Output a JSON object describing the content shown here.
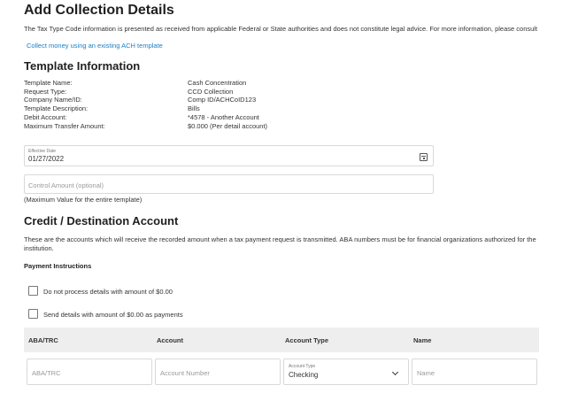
{
  "page": {
    "title": "Add Collection Details",
    "disclaimer": "The Tax Type Code information is presented as received from applicable Federal or State authorities and does not constitute legal advice. For more information, please consult",
    "template_link": "Collect money using an existing ACH template"
  },
  "template_info": {
    "heading": "Template Information",
    "rows": [
      {
        "label": "Template Name:",
        "value": "Cash Concentration"
      },
      {
        "label": "Request Type:",
        "value": "CCD Collection"
      },
      {
        "label": "Company Name/ID:",
        "value": "Comp ID/ACHCoID123"
      },
      {
        "label": "Template Description:",
        "value": "Bills"
      },
      {
        "label": "Debit Account:",
        "value": "*4578 - Another Account"
      },
      {
        "label": "Maximum Transfer Amount:",
        "value": "$0.000 (Per detail account)"
      }
    ]
  },
  "effective_date": {
    "label": "Effective Date",
    "value": "01/27/2022",
    "icon": "calendar-icon"
  },
  "control_amount": {
    "placeholder": "Control Amount (optional)",
    "hint": "(Maximum Value for the entire template)"
  },
  "credit_section": {
    "heading": "Credit / Destination Account",
    "description_line1": "These are the accounts which will receive the recorded amount when a tax payment request is transmitted. ABA numbers must be for financial organizations authorized for the",
    "description_line2": "institution.",
    "payment_instructions": "Payment Instructions",
    "checkbox1": "Do not process details with amount of $0.00",
    "checkbox2": "Send details with amount of $0.00 as payments"
  },
  "table": {
    "headers": [
      "ABA/TRC",
      "Account",
      "Account Type",
      "Name"
    ],
    "row": {
      "aba_placeholder": "ABA/TRC",
      "account_placeholder": "Account Number",
      "account_type_label": "Account Type",
      "account_type_value": "Checking",
      "name_placeholder": "Name"
    }
  }
}
